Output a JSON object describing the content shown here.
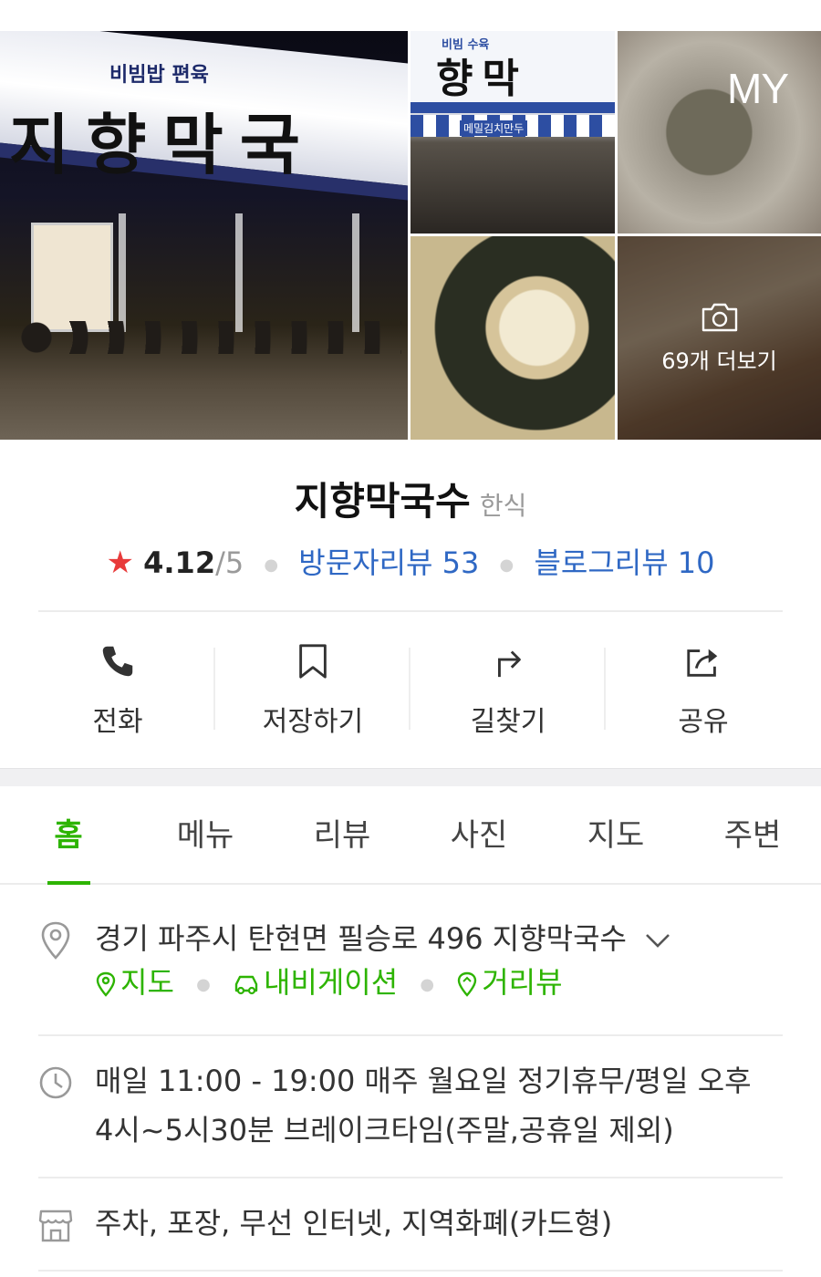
{
  "photos": {
    "main_sign_sub": "비빔밥    편육",
    "main_sign": "지향막국",
    "thumb_sign_sub": "비빔    수육",
    "thumb_sign": "향막",
    "thumb_strip": "메밀김치만두",
    "my_badge": "MY",
    "more_label": "69개 더보기"
  },
  "place": {
    "name": "지향막국수",
    "category": "한식",
    "rating": "4.12",
    "rating_max": "/5",
    "visitor_reviews": "방문자리뷰 53",
    "blog_reviews": "블로그리뷰 10"
  },
  "actions": [
    {
      "label": "전화",
      "icon": "phone-icon"
    },
    {
      "label": "저장하기",
      "icon": "bookmark-icon"
    },
    {
      "label": "길찾기",
      "icon": "directions-icon"
    },
    {
      "label": "공유",
      "icon": "share-icon"
    }
  ],
  "tabs": [
    {
      "label": "홈",
      "active": true
    },
    {
      "label": "메뉴"
    },
    {
      "label": "리뷰"
    },
    {
      "label": "사진"
    },
    {
      "label": "지도"
    },
    {
      "label": "주변"
    }
  ],
  "info": {
    "address": "경기 파주시 탄현면 필승로 496 지향막국수",
    "map_link": "지도",
    "navigation_link": "내비게이션",
    "streetview_link": "거리뷰",
    "hours_line1": "매일 11:00 - 19:00 매주 월요일 정기휴무/평일 오후",
    "hours_line2": "4시~5시30분 브레이크타임(주말,공휴일 제외)",
    "amenities": "주차, 포장, 무선 인터넷, 지역화폐(카드형)"
  },
  "colors": {
    "accent_green": "#2db400",
    "link_blue": "#2f68c4",
    "star_red": "#e83b3b"
  }
}
